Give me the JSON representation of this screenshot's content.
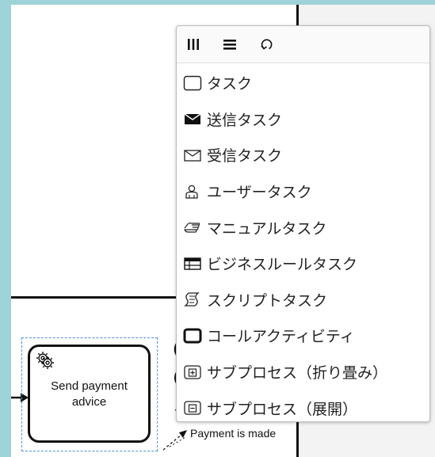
{
  "popup": {
    "header": {
      "icons": [
        "column-layout-icon",
        "row-layout-icon",
        "loop-icon"
      ]
    },
    "entries": [
      {
        "label": "タスク",
        "icon": "task-icon"
      },
      {
        "label": "送信タスク",
        "icon": "send-envelope-icon"
      },
      {
        "label": "受信タスク",
        "icon": "receive-envelope-icon"
      },
      {
        "label": "ユーザータスク",
        "icon": "user-icon"
      },
      {
        "label": "マニュアルタスク",
        "icon": "hand-icon"
      },
      {
        "label": "ビジネスルールタスク",
        "icon": "table-icon"
      },
      {
        "label": "スクリプトタスク",
        "icon": "script-icon"
      },
      {
        "label": "コールアクティビティ",
        "icon": "call-activity-icon"
      },
      {
        "label": "サブプロセス（折り畳み）",
        "icon": "subprocess-collapsed-icon"
      },
      {
        "label": "サブプロセス（展開）",
        "icon": "subprocess-expanded-icon"
      }
    ]
  },
  "diagram": {
    "task_label": "Send payment advice",
    "task_icon": "gear-icon",
    "flow_label": "Payment is made"
  }
}
